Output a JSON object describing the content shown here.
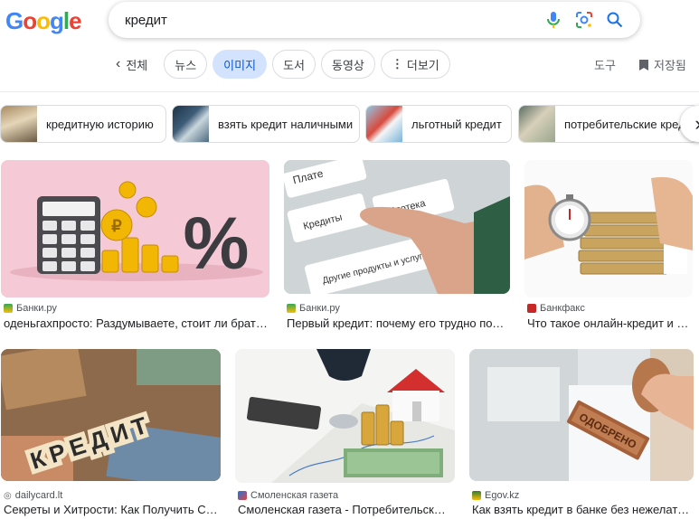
{
  "logo": {
    "letters": [
      "G",
      "o",
      "o",
      "g",
      "l",
      "e"
    ]
  },
  "search": {
    "query": "кредит"
  },
  "tabs": {
    "back": "전체",
    "items": [
      "뉴스",
      "이미지",
      "도서",
      "동영상",
      "더보기"
    ],
    "active": "이미지",
    "tools": "도구",
    "saved": "저장됨"
  },
  "chips": [
    "кредитную историю",
    "взять кредит наличными",
    "льготный кредит",
    "потребительские кредиты"
  ],
  "results": [
    {
      "source": "Банки.ру",
      "title": "оденьгахпросто: Раздумываете, стоит ли брать кредит"
    },
    {
      "source": "Банки.ру",
      "title": "Первый кредит: почему его трудно получить"
    },
    {
      "source": "Банкфакс",
      "title": "Что такое онлайн-кредит и как его получить"
    },
    {
      "source": "dailycard.lt",
      "title": "Секреты и Хитрости: Как Получить Скидку"
    },
    {
      "source": "Смоленская газета",
      "title": "Смоленская газета - Потребительский кредит"
    },
    {
      "source": "Egov.kz",
      "title": "Как взять кредит в банке без нежелательных последствий"
    }
  ],
  "images": {
    "r1_tiles": [
      "Плате",
      "Кредиты",
      "Ипотека",
      "Другие продукты и услуги"
    ],
    "r3_word": "КРЕДИТ",
    "r5_stamp": "ОДОБРЕНО",
    "r0_sign": "%"
  },
  "colors": {
    "accent": "#0b57d0",
    "active_tab_bg": "#d3e3fd"
  }
}
